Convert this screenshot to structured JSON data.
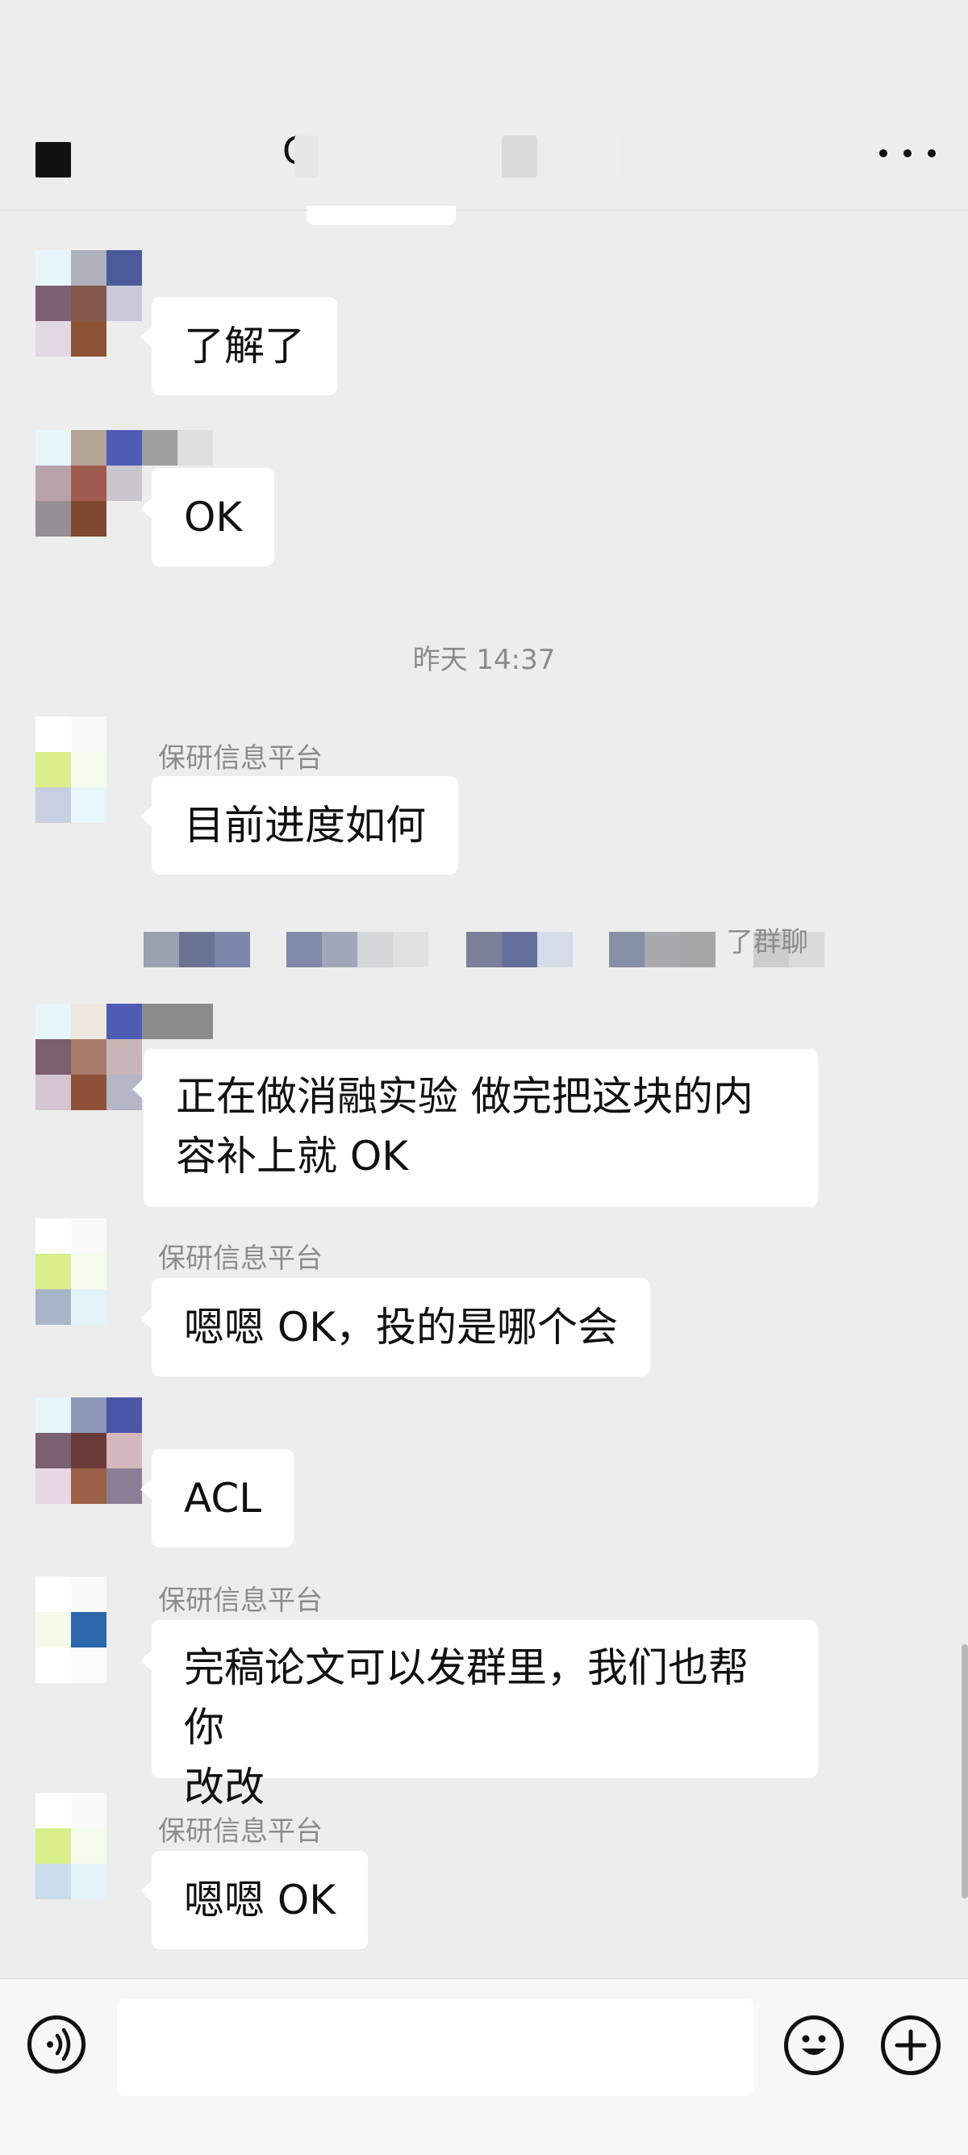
{
  "header": {
    "title_fragment": "C",
    "more_label": "•••"
  },
  "timestamp": "昨天 14:37",
  "messages": [
    {
      "sender": "",
      "text": "了解了"
    },
    {
      "sender": "",
      "text": "OK"
    },
    {
      "sender": "保研信息平台",
      "text": "目前进度如何"
    },
    {
      "sender": "",
      "text_line1": "正在做消融实验 做完把这块的内",
      "text_line2": "容补上就 OK"
    },
    {
      "sender": "保研信息平台",
      "text": "嗯嗯 OK，投的是哪个会"
    },
    {
      "sender": "",
      "text": "ACL"
    },
    {
      "sender": "保研信息平台",
      "text_line1": "完稿论文可以发群里，我们也帮你",
      "text_line2": "改改"
    },
    {
      "sender": "保研信息平台",
      "text": "嗯嗯 OK"
    }
  ],
  "blur_strip_fragment": "了群聊",
  "input": {
    "value": "",
    "placeholder": ""
  },
  "icons": {
    "back": "back-icon",
    "more": "more-icon",
    "voice": "voice-icon",
    "emoji": "emoji-icon",
    "add": "add-icon"
  },
  "colors": {
    "background": "#ededed",
    "bubble": "#ffffff",
    "sender_text": "#8c8c8c"
  }
}
